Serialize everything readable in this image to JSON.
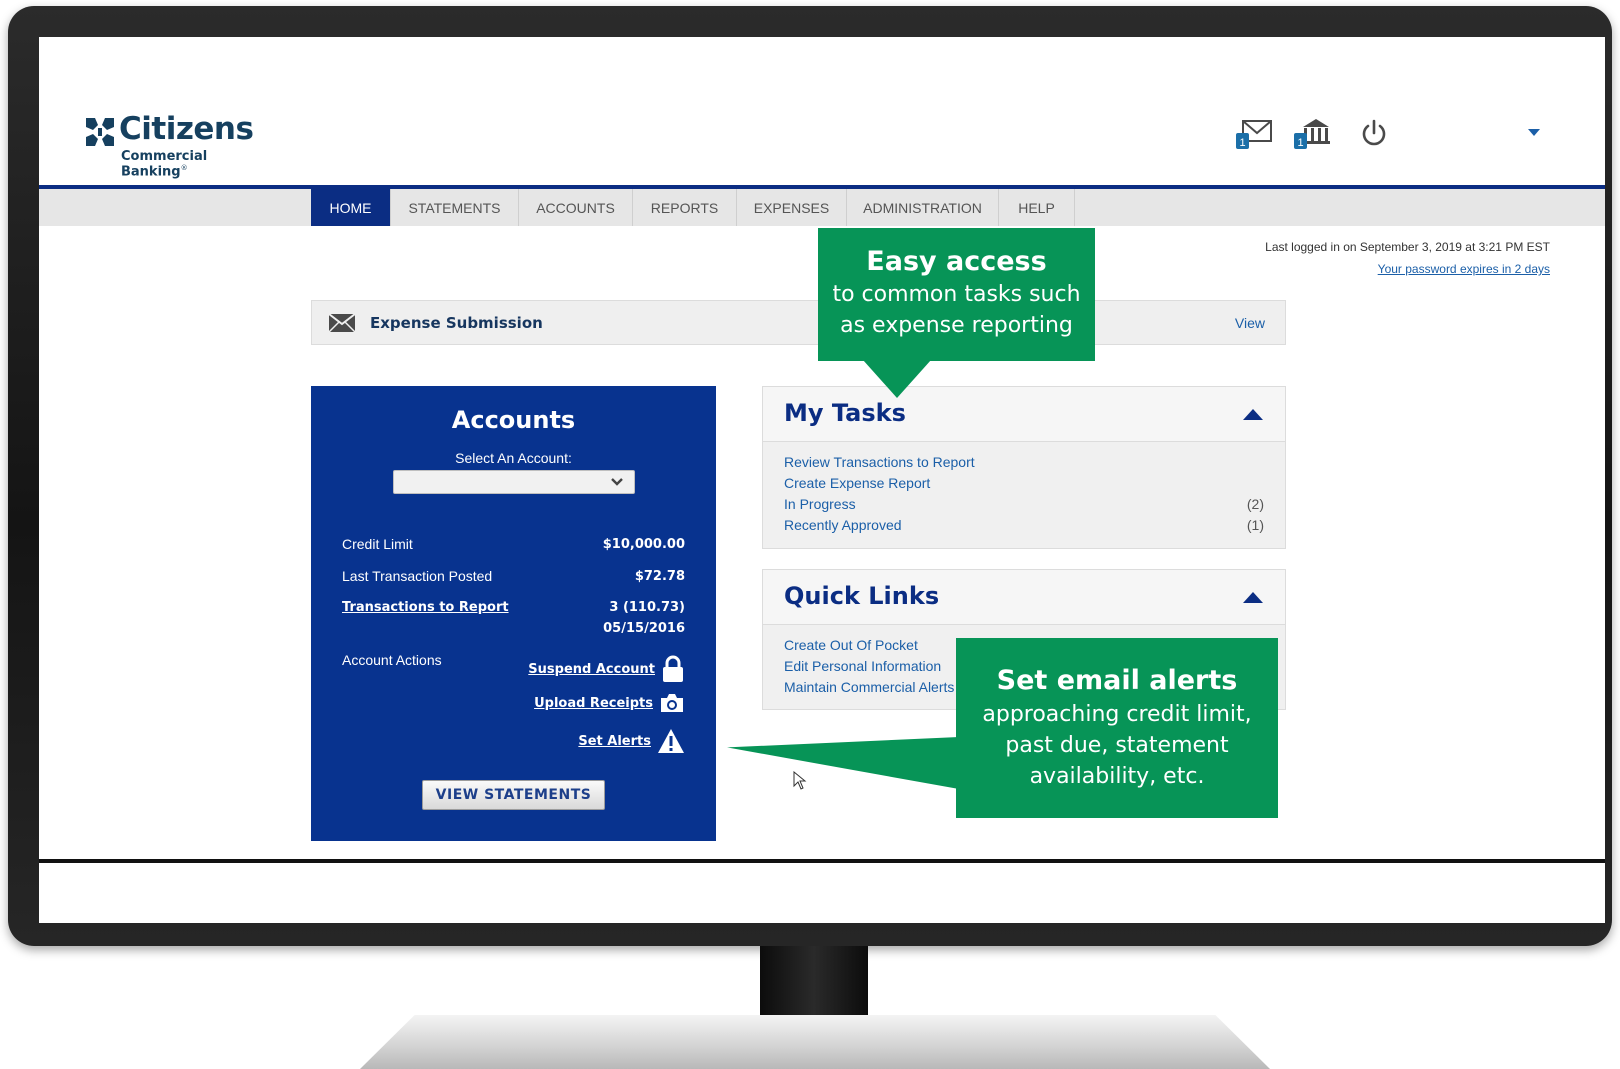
{
  "brand": {
    "name": "Citizens",
    "subtitle": "Commercial Banking",
    "registered_mark": "®"
  },
  "header": {
    "icons": [
      "mail-icon",
      "bank-icon",
      "power-icon"
    ],
    "mail_badge": "1",
    "bank_badge": "1",
    "user_menu_value": ""
  },
  "nav": {
    "tabs": [
      {
        "label": "HOME",
        "active": true
      },
      {
        "label": "STATEMENTS",
        "active": false
      },
      {
        "label": "ACCOUNTS",
        "active": false
      },
      {
        "label": "REPORTS",
        "active": false
      },
      {
        "label": "EXPENSES",
        "active": false
      },
      {
        "label": "ADMINISTRATION",
        "active": false
      },
      {
        "label": "HELP",
        "active": false
      }
    ]
  },
  "session": {
    "last_login": "Last logged in on September 3, 2019 at 3:21 PM EST",
    "password_notice": "Your password expires in 2 days"
  },
  "expense_bar": {
    "icon": "envelope-icon",
    "title": "Expense Submission",
    "view_label": "View"
  },
  "accounts": {
    "title": "Accounts",
    "select_label": "Select An Account:",
    "select_value": "",
    "credit_limit_label": "Credit Limit",
    "credit_limit_value": "$10,000.00",
    "last_txn_label": "Last Transaction Posted",
    "last_txn_value": "$72.78",
    "txn_report_label": "Transactions to Report",
    "txn_report_value": "3 (110.73)",
    "txn_report_date": "05/15/2016",
    "actions_label": "Account Actions",
    "actions": [
      {
        "label": "Suspend Account",
        "icon": "lock-icon"
      },
      {
        "label": "Upload Receipts",
        "icon": "camera-icon"
      },
      {
        "label": "Set Alerts",
        "icon": "warning-icon"
      }
    ],
    "view_statements": "VIEW STATEMENTS"
  },
  "my_tasks": {
    "title": "My Tasks",
    "items": [
      {
        "label": "Review Transactions to Report",
        "count": ""
      },
      {
        "label": "Create Expense Report",
        "count": ""
      },
      {
        "label": "In Progress",
        "count": "(2)"
      },
      {
        "label": "Recently Approved",
        "count": "(1)"
      }
    ]
  },
  "quick_links": {
    "title": "Quick Links",
    "items": [
      {
        "label": "Create Out Of Pocket"
      },
      {
        "label": "Edit Personal Information"
      },
      {
        "label": "Maintain Commercial Alerts"
      }
    ]
  },
  "callouts": {
    "easy_access_title": "Easy access",
    "easy_access_line1": "to common tasks such",
    "easy_access_line2": "as expense reporting",
    "alerts_title": "Set email alerts",
    "alerts_line1": "approaching credit limit,",
    "alerts_line2": "past due, statement",
    "alerts_line3": "availability, etc."
  },
  "colors": {
    "navy": "#0b2d83",
    "panel_blue": "#08338f",
    "callout_green": "#079457",
    "link_blue": "#1b5fa8"
  }
}
